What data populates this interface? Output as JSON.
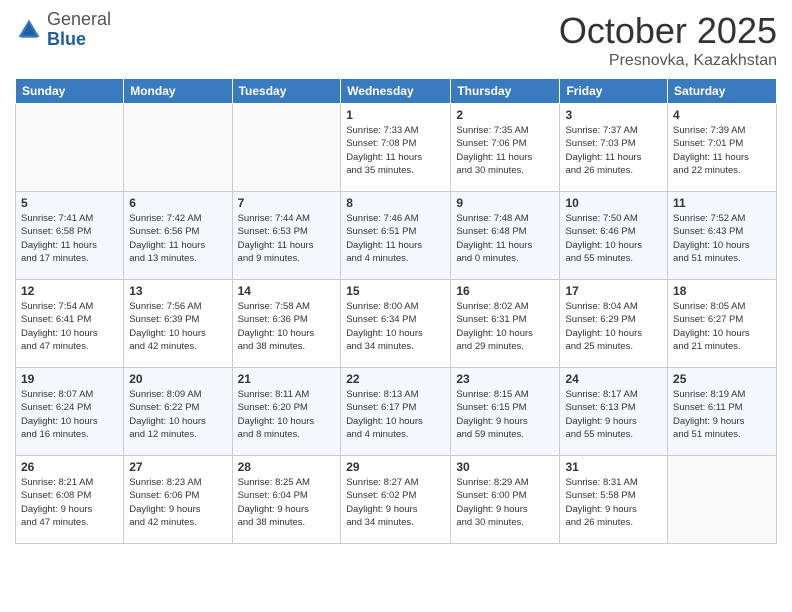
{
  "header": {
    "logo_general": "General",
    "logo_blue": "Blue",
    "month": "October 2025",
    "location": "Presnovka, Kazakhstan"
  },
  "days_of_week": [
    "Sunday",
    "Monday",
    "Tuesday",
    "Wednesday",
    "Thursday",
    "Friday",
    "Saturday"
  ],
  "weeks": [
    [
      {
        "day": "",
        "info": ""
      },
      {
        "day": "",
        "info": ""
      },
      {
        "day": "",
        "info": ""
      },
      {
        "day": "1",
        "info": "Sunrise: 7:33 AM\nSunset: 7:08 PM\nDaylight: 11 hours\nand 35 minutes."
      },
      {
        "day": "2",
        "info": "Sunrise: 7:35 AM\nSunset: 7:06 PM\nDaylight: 11 hours\nand 30 minutes."
      },
      {
        "day": "3",
        "info": "Sunrise: 7:37 AM\nSunset: 7:03 PM\nDaylight: 11 hours\nand 26 minutes."
      },
      {
        "day": "4",
        "info": "Sunrise: 7:39 AM\nSunset: 7:01 PM\nDaylight: 11 hours\nand 22 minutes."
      }
    ],
    [
      {
        "day": "5",
        "info": "Sunrise: 7:41 AM\nSunset: 6:58 PM\nDaylight: 11 hours\nand 17 minutes."
      },
      {
        "day": "6",
        "info": "Sunrise: 7:42 AM\nSunset: 6:56 PM\nDaylight: 11 hours\nand 13 minutes."
      },
      {
        "day": "7",
        "info": "Sunrise: 7:44 AM\nSunset: 6:53 PM\nDaylight: 11 hours\nand 9 minutes."
      },
      {
        "day": "8",
        "info": "Sunrise: 7:46 AM\nSunset: 6:51 PM\nDaylight: 11 hours\nand 4 minutes."
      },
      {
        "day": "9",
        "info": "Sunrise: 7:48 AM\nSunset: 6:48 PM\nDaylight: 11 hours\nand 0 minutes."
      },
      {
        "day": "10",
        "info": "Sunrise: 7:50 AM\nSunset: 6:46 PM\nDaylight: 10 hours\nand 55 minutes."
      },
      {
        "day": "11",
        "info": "Sunrise: 7:52 AM\nSunset: 6:43 PM\nDaylight: 10 hours\nand 51 minutes."
      }
    ],
    [
      {
        "day": "12",
        "info": "Sunrise: 7:54 AM\nSunset: 6:41 PM\nDaylight: 10 hours\nand 47 minutes."
      },
      {
        "day": "13",
        "info": "Sunrise: 7:56 AM\nSunset: 6:39 PM\nDaylight: 10 hours\nand 42 minutes."
      },
      {
        "day": "14",
        "info": "Sunrise: 7:58 AM\nSunset: 6:36 PM\nDaylight: 10 hours\nand 38 minutes."
      },
      {
        "day": "15",
        "info": "Sunrise: 8:00 AM\nSunset: 6:34 PM\nDaylight: 10 hours\nand 34 minutes."
      },
      {
        "day": "16",
        "info": "Sunrise: 8:02 AM\nSunset: 6:31 PM\nDaylight: 10 hours\nand 29 minutes."
      },
      {
        "day": "17",
        "info": "Sunrise: 8:04 AM\nSunset: 6:29 PM\nDaylight: 10 hours\nand 25 minutes."
      },
      {
        "day": "18",
        "info": "Sunrise: 8:05 AM\nSunset: 6:27 PM\nDaylight: 10 hours\nand 21 minutes."
      }
    ],
    [
      {
        "day": "19",
        "info": "Sunrise: 8:07 AM\nSunset: 6:24 PM\nDaylight: 10 hours\nand 16 minutes."
      },
      {
        "day": "20",
        "info": "Sunrise: 8:09 AM\nSunset: 6:22 PM\nDaylight: 10 hours\nand 12 minutes."
      },
      {
        "day": "21",
        "info": "Sunrise: 8:11 AM\nSunset: 6:20 PM\nDaylight: 10 hours\nand 8 minutes."
      },
      {
        "day": "22",
        "info": "Sunrise: 8:13 AM\nSunset: 6:17 PM\nDaylight: 10 hours\nand 4 minutes."
      },
      {
        "day": "23",
        "info": "Sunrise: 8:15 AM\nSunset: 6:15 PM\nDaylight: 9 hours\nand 59 minutes."
      },
      {
        "day": "24",
        "info": "Sunrise: 8:17 AM\nSunset: 6:13 PM\nDaylight: 9 hours\nand 55 minutes."
      },
      {
        "day": "25",
        "info": "Sunrise: 8:19 AM\nSunset: 6:11 PM\nDaylight: 9 hours\nand 51 minutes."
      }
    ],
    [
      {
        "day": "26",
        "info": "Sunrise: 8:21 AM\nSunset: 6:08 PM\nDaylight: 9 hours\nand 47 minutes."
      },
      {
        "day": "27",
        "info": "Sunrise: 8:23 AM\nSunset: 6:06 PM\nDaylight: 9 hours\nand 42 minutes."
      },
      {
        "day": "28",
        "info": "Sunrise: 8:25 AM\nSunset: 6:04 PM\nDaylight: 9 hours\nand 38 minutes."
      },
      {
        "day": "29",
        "info": "Sunrise: 8:27 AM\nSunset: 6:02 PM\nDaylight: 9 hours\nand 34 minutes."
      },
      {
        "day": "30",
        "info": "Sunrise: 8:29 AM\nSunset: 6:00 PM\nDaylight: 9 hours\nand 30 minutes."
      },
      {
        "day": "31",
        "info": "Sunrise: 8:31 AM\nSunset: 5:58 PM\nDaylight: 9 hours\nand 26 minutes."
      },
      {
        "day": "",
        "info": ""
      }
    ]
  ]
}
